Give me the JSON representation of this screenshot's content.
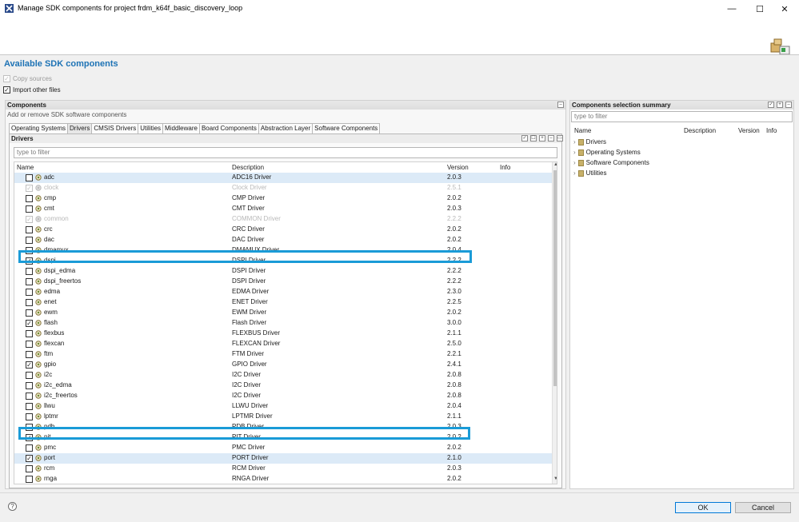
{
  "window": {
    "title": "Manage SDK components for project frdm_k64f_basic_discovery_loop",
    "minimize": "—",
    "maximize": "☐",
    "close": "✕"
  },
  "header": {
    "title": "Available SDK components",
    "options": [
      {
        "label": "Copy sources",
        "checked": true,
        "disabled": true
      },
      {
        "label": "Import other files",
        "checked": true,
        "disabled": false
      }
    ]
  },
  "components_panel": {
    "title": "Components",
    "subtitle": "Add or remove SDK software components",
    "tabs": [
      "Operating Systems",
      "Drivers",
      "CMSIS Drivers",
      "Utilities",
      "Middleware",
      "Board Components",
      "Abstraction Layer",
      "Software Components"
    ],
    "active_tab": "Drivers",
    "section_title": "Drivers",
    "filter_placeholder": "type to filter",
    "columns": [
      "Name",
      "Description",
      "Version",
      "Info"
    ],
    "rows": [
      {
        "name": "adc",
        "description": "ADC16 Driver",
        "version": "2.0.3",
        "checked": false,
        "greyed": false
      },
      {
        "name": "clock",
        "description": "Clock Driver",
        "version": "2.5.1",
        "checked": true,
        "greyed": true
      },
      {
        "name": "cmp",
        "description": "CMP Driver",
        "version": "2.0.2",
        "checked": false,
        "greyed": false
      },
      {
        "name": "cmt",
        "description": "CMT Driver",
        "version": "2.0.3",
        "checked": false,
        "greyed": false
      },
      {
        "name": "common",
        "description": "COMMON Driver",
        "version": "2.2.2",
        "checked": true,
        "greyed": true
      },
      {
        "name": "crc",
        "description": "CRC Driver",
        "version": "2.0.2",
        "checked": false,
        "greyed": false
      },
      {
        "name": "dac",
        "description": "DAC Driver",
        "version": "2.0.2",
        "checked": false,
        "greyed": false
      },
      {
        "name": "dmamux",
        "description": "DMAMUX Driver",
        "version": "2.0.4",
        "checked": false,
        "greyed": false
      },
      {
        "name": "dspi",
        "description": "DSPI Driver",
        "version": "2.2.2",
        "checked": true,
        "greyed": false
      },
      {
        "name": "dspi_edma",
        "description": "DSPI Driver",
        "version": "2.2.2",
        "checked": false,
        "greyed": false
      },
      {
        "name": "dspi_freertos",
        "description": "DSPI Driver",
        "version": "2.2.2",
        "checked": false,
        "greyed": false
      },
      {
        "name": "edma",
        "description": "EDMA Driver",
        "version": "2.3.0",
        "checked": false,
        "greyed": false
      },
      {
        "name": "enet",
        "description": "ENET Driver",
        "version": "2.2.5",
        "checked": false,
        "greyed": false
      },
      {
        "name": "ewm",
        "description": "EWM Driver",
        "version": "2.0.2",
        "checked": false,
        "greyed": false
      },
      {
        "name": "flash",
        "description": "Flash Driver",
        "version": "3.0.0",
        "checked": true,
        "greyed": false
      },
      {
        "name": "flexbus",
        "description": "FLEXBUS Driver",
        "version": "2.1.1",
        "checked": false,
        "greyed": false
      },
      {
        "name": "flexcan",
        "description": "FLEXCAN Driver",
        "version": "2.5.0",
        "checked": false,
        "greyed": false
      },
      {
        "name": "ftm",
        "description": "FTM Driver",
        "version": "2.2.1",
        "checked": false,
        "greyed": false
      },
      {
        "name": "gpio",
        "description": "GPIO Driver",
        "version": "2.4.1",
        "checked": true,
        "greyed": false
      },
      {
        "name": "i2c",
        "description": "I2C Driver",
        "version": "2.0.8",
        "checked": false,
        "greyed": false
      },
      {
        "name": "i2c_edma",
        "description": "I2C Driver",
        "version": "2.0.8",
        "checked": false,
        "greyed": false
      },
      {
        "name": "i2c_freertos",
        "description": "I2C Driver",
        "version": "2.0.8",
        "checked": false,
        "greyed": false
      },
      {
        "name": "llwu",
        "description": "LLWU Driver",
        "version": "2.0.4",
        "checked": false,
        "greyed": false
      },
      {
        "name": "lptmr",
        "description": "LPTMR Driver",
        "version": "2.1.1",
        "checked": false,
        "greyed": false
      },
      {
        "name": "pdb",
        "description": "PDB Driver",
        "version": "2.0.3",
        "checked": false,
        "greyed": false
      },
      {
        "name": "pit",
        "description": "PIT Driver",
        "version": "2.0.2",
        "checked": true,
        "greyed": false
      },
      {
        "name": "pmc",
        "description": "PMC Driver",
        "version": "2.0.2",
        "checked": false,
        "greyed": false
      },
      {
        "name": "port",
        "description": "PORT Driver",
        "version": "2.1.0",
        "checked": true,
        "greyed": false
      },
      {
        "name": "rcm",
        "description": "RCM Driver",
        "version": "2.0.3",
        "checked": false,
        "greyed": false
      },
      {
        "name": "rnga",
        "description": "RNGA Driver",
        "version": "2.0.2",
        "checked": false,
        "greyed": false
      }
    ]
  },
  "summary_panel": {
    "title": "Components selection summary",
    "filter_placeholder": "type to filter",
    "columns": [
      "Name",
      "Description",
      "Version",
      "Info"
    ],
    "items": [
      "Drivers",
      "Operating Systems",
      "Software Components",
      "Utilities"
    ]
  },
  "footer": {
    "help": "?",
    "ok_label": "OK",
    "cancel_label": "Cancel"
  },
  "colors": {
    "accent": "#1e73b5",
    "highlight_box": "#1a9bd7",
    "selected_row": "#dceaf7"
  }
}
